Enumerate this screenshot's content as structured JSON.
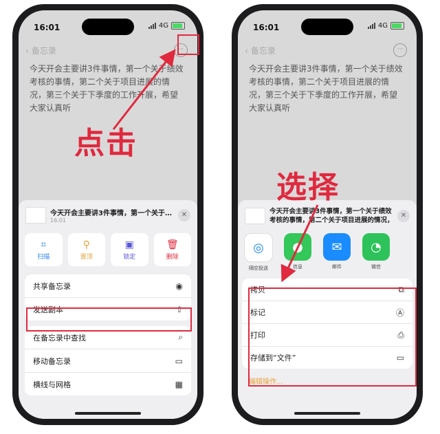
{
  "colors": {
    "accent_red": "#e0293e",
    "notes_yellow": "#e8a33a",
    "sheet_bg": "#efeff2"
  },
  "status": {
    "time": "16:01",
    "network": "4G"
  },
  "nav": {
    "back_label": "备忘录",
    "more_icon": "ellipsis-circle-icon"
  },
  "note_text": "今天开会主要讲3件事情，第一个关于绩效考核的事情，第二个关于项目进展的情况，第三个关于下季度的工作开展，希望大家认真听",
  "left": {
    "callout": "点击",
    "sheet": {
      "title": "今天开会主要讲3件事情，第一个关于绩…",
      "subtitle": "16:01",
      "actions": [
        {
          "label": "扫描",
          "icon": "scan-icon",
          "color": "#2f80ed"
        },
        {
          "label": "置顶",
          "icon": "pin-icon",
          "color": "#e8a33a"
        },
        {
          "label": "锁定",
          "icon": "lock-icon",
          "color": "#5856d6"
        },
        {
          "label": "删除",
          "icon": "trash-icon",
          "color": "#e0293e"
        }
      ],
      "menu_group1": [
        {
          "label": "共享备忘录",
          "icon": "person-add-icon"
        },
        {
          "label": "发送副本",
          "icon": "share-icon"
        }
      ],
      "menu_group2": [
        {
          "label": "在备忘录中查找",
          "icon": "search-icon"
        },
        {
          "label": "移动备忘录",
          "icon": "folder-icon"
        },
        {
          "label": "横线与网格",
          "icon": "grid-icon"
        }
      ]
    }
  },
  "right": {
    "callout": "选择",
    "sheet": {
      "title": "今天开会主要讲3件事情，第一个关于绩效考核的事情，第二个关于项目进展的情况，",
      "apps": [
        {
          "label": "隔空投送",
          "icon": "airdrop-icon",
          "color": "#ffffff"
        },
        {
          "label": "信息",
          "icon": "message-icon",
          "color": "#34c759"
        },
        {
          "label": "邮件",
          "icon": "mail-icon",
          "color": "#1a8cff"
        },
        {
          "label": "微信",
          "icon": "wechat-icon",
          "color": "#2ec25b"
        }
      ],
      "menu": [
        {
          "label": "拷贝",
          "icon": "copy-icon"
        },
        {
          "label": "标记",
          "icon": "markup-icon"
        },
        {
          "label": "打印",
          "icon": "printer-icon"
        },
        {
          "label": "存储到“文件”",
          "icon": "folder-icon"
        }
      ],
      "edit_label": "编辑操作..."
    }
  }
}
